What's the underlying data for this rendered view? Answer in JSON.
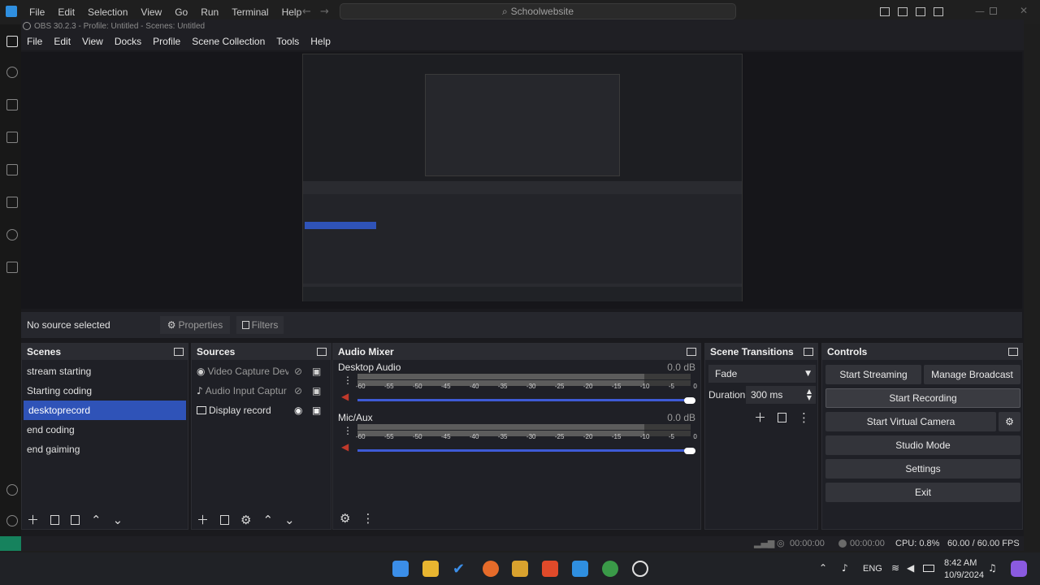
{
  "vscode": {
    "menu": [
      "File",
      "Edit",
      "Selection",
      "View",
      "Go",
      "Run",
      "Terminal",
      "Help"
    ],
    "search": "Schoolwebsite"
  },
  "obs": {
    "title": "OBS 30.2.3 - Profile: Untitled - Scenes: Untitled",
    "menu": [
      "File",
      "Edit",
      "View",
      "Docks",
      "Profile",
      "Scene Collection",
      "Tools",
      "Help"
    ],
    "source_bar": {
      "status": "No source selected",
      "properties": "Properties",
      "filters": "Filters"
    },
    "scenes": {
      "title": "Scenes",
      "items": [
        "stream starting",
        "Starting coding",
        "desktoprecord",
        "end coding",
        "end gaiming"
      ],
      "selected_index": 2
    },
    "sources": {
      "title": "Sources",
      "items": [
        {
          "label": "Video Capture Devic",
          "icon": "camera-icon",
          "visible": false
        },
        {
          "label": "Audio Input Capture",
          "icon": "microphone-icon",
          "visible": false
        },
        {
          "label": "Display record",
          "icon": "monitor-icon",
          "visible": true
        }
      ]
    },
    "audio_mixer": {
      "title": "Audio Mixer",
      "scale": [
        "-60",
        "-55",
        "-50",
        "-45",
        "-40",
        "-35",
        "-30",
        "-25",
        "-20",
        "-15",
        "-10",
        "-5",
        "0"
      ],
      "channels": [
        {
          "name": "Desktop Audio",
          "db": "0.0 dB",
          "volume": 1.0
        },
        {
          "name": "Mic/Aux",
          "db": "0.0 dB",
          "volume": 1.0
        }
      ]
    },
    "transitions": {
      "title": "Scene Transitions",
      "selected": "Fade",
      "duration_label": "Duration",
      "duration_value": "300 ms"
    },
    "controls": {
      "title": "Controls",
      "start_streaming": "Start Streaming",
      "manage_broadcast": "Manage Broadcast",
      "start_recording": "Start Recording",
      "start_virtual_camera": "Start Virtual Camera",
      "studio_mode": "Studio Mode",
      "settings": "Settings",
      "exit": "Exit"
    },
    "status": {
      "stream_time": "00:00:00",
      "record_time": "00:00:00",
      "cpu": "CPU: 0.8%",
      "fps": "60.00 / 60.00 FPS"
    }
  },
  "taskbar": {
    "time": "8:42 AM",
    "date": "10/9/2024",
    "lang": "ENG"
  },
  "colors": {
    "accent": "#2f53b8",
    "slider": "#3e5bd6",
    "mute": "#c0392b"
  }
}
